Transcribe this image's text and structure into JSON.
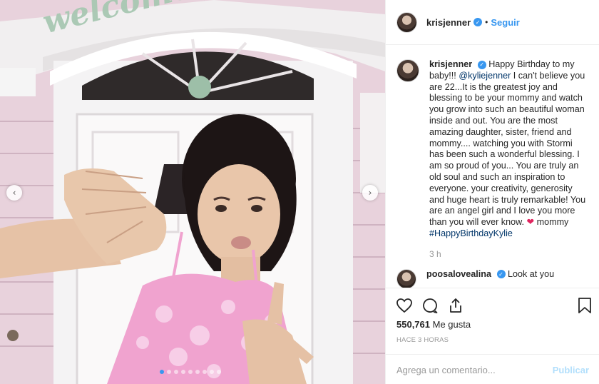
{
  "post": {
    "username": "krisjenner",
    "follow_label": "Seguir",
    "separator": "•"
  },
  "caption": {
    "username": "krisjenner",
    "text_before_mention": "Happy Birthday to my baby!!! ",
    "mention": "@kyliejenner",
    "text_after_mention": " I can't believe you are 22...It is the greatest joy and blessing to be your mommy and watch you grow into such an beautiful woman inside and out. You are the most amazing daughter, sister, friend and mommy.... watching you with Stormi has been such a wonderful blessing. I am so proud of you... You are truly an old soul and such an inspiration to everyone. your creativity, generosity and huge heart is truly remarkable! You are an angel girl and I love you more than you will ever know. ",
    "heart": "❤",
    "text_signoff": " mommy ",
    "hashtag": "#HappyBirthdayKylie",
    "time": "3 h"
  },
  "next_comment": {
    "username": "poosalovealina",
    "text": "Look at you"
  },
  "actions": {
    "likes_count": "550,761",
    "likes_label": "Me gusta",
    "posted_ago": "HACE 3 HORAS",
    "comment_placeholder": "Agrega un comentario...",
    "publish_label": "Publicar"
  },
  "photo": {
    "sign_text": "welcome friends",
    "slide_count": 9,
    "active_slide": 0
  },
  "icons": {
    "left_arrow": "‹",
    "right_arrow": "›",
    "verified": "✓"
  },
  "colors": {
    "accent": "#3897f0",
    "muted": "#999999",
    "mention": "#003569",
    "publish_disabled": "#b2dffc"
  }
}
